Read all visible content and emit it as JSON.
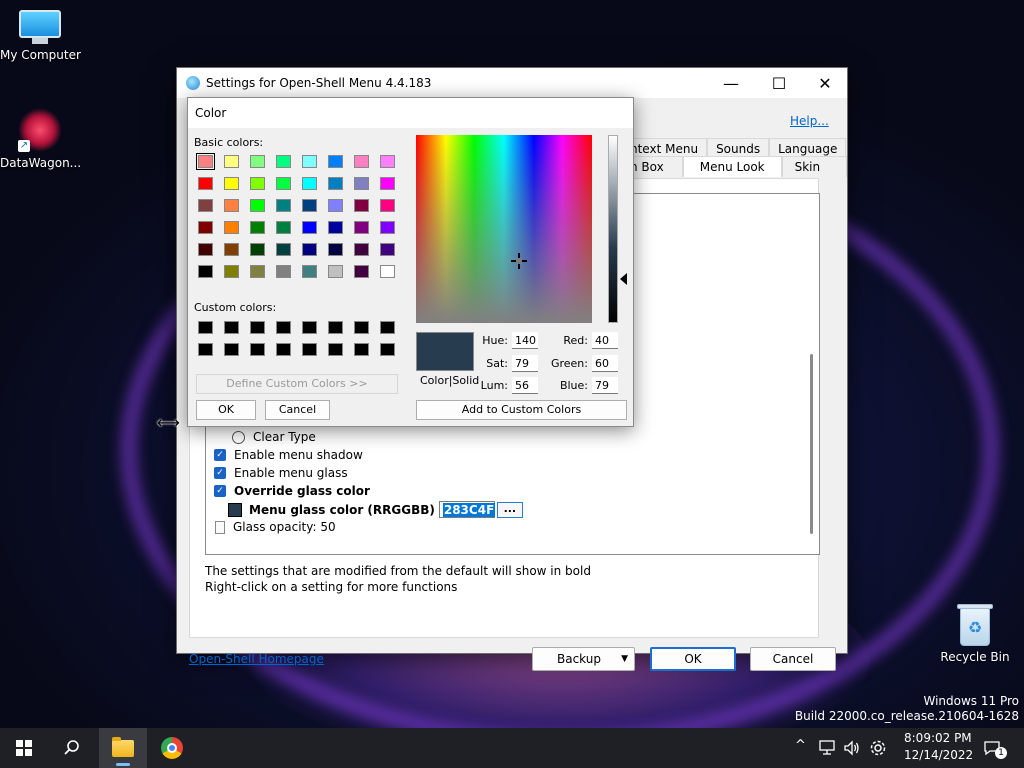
{
  "desktop": {
    "icons": [
      {
        "label": "My Computer"
      },
      {
        "label": "DataWagon..."
      },
      {
        "label": "Recycle Bin"
      }
    ],
    "watermark": {
      "line1": "Windows 11 Pro",
      "line2": "Build 22000.co_release.210604-1628"
    }
  },
  "settings_window": {
    "title": "Settings for Open-Shell Menu 4.4.183",
    "controls": {
      "minimize": "—",
      "maximize": "☐",
      "close": "✕"
    },
    "help_link": "Help...",
    "tabs_row1": [
      "ntext Menu",
      "Sounds",
      "Language"
    ],
    "tabs_row2": [
      "h Box",
      "Menu Look",
      "Skin"
    ],
    "active_tab": "Menu Look",
    "options": {
      "clear_type": "Clear Type",
      "menu_shadow": "Enable menu shadow",
      "menu_glass": "Enable menu glass",
      "override_glass": "Override glass color",
      "glass_color_label": "Menu glass color (RRGGBB)",
      "glass_color_value": "283C4F",
      "glass_color_button": "...",
      "glass_opacity": "Glass opacity: 50"
    },
    "footnote1": "The settings that are modified from the default will show in bold",
    "footnote2": "Right-click on a setting for more functions",
    "homepage_link": "Open-Shell Homepage",
    "buttons": {
      "backup": "Backup",
      "ok": "OK",
      "cancel": "Cancel"
    }
  },
  "color_dialog": {
    "title": "Color",
    "basic_colors_label": "Basic colors:",
    "custom_colors_label": "Custom colors:",
    "basic_colors": [
      [
        "#ff8080",
        "#ffff80",
        "#80ff80",
        "#00ff80",
        "#80ffff",
        "#0080ff",
        "#ff80c0",
        "#ff80ff"
      ],
      [
        "#ff0000",
        "#ffff00",
        "#80ff00",
        "#00ff40",
        "#00ffff",
        "#0080c0",
        "#8080c0",
        "#ff00ff"
      ],
      [
        "#804040",
        "#ff8040",
        "#00ff00",
        "#008080",
        "#004080",
        "#8080ff",
        "#800040",
        "#ff0080"
      ],
      [
        "#800000",
        "#ff8000",
        "#008000",
        "#008040",
        "#0000ff",
        "#0000a0",
        "#800080",
        "#8000ff"
      ],
      [
        "#400000",
        "#804000",
        "#004000",
        "#004040",
        "#000080",
        "#000040",
        "#400040",
        "#400080"
      ],
      [
        "#000000",
        "#808000",
        "#808040",
        "#808080",
        "#408080",
        "#c0c0c0",
        "#400040",
        "#ffffff"
      ]
    ],
    "custom_colors": [
      "#000000",
      "#000000",
      "#000000",
      "#000000",
      "#000000",
      "#000000",
      "#000000",
      "#000000",
      "#000000",
      "#000000",
      "#000000",
      "#000000",
      "#000000",
      "#000000",
      "#000000",
      "#000000"
    ],
    "define_custom_button": "Define Custom Colors >>",
    "ok_button": "OK",
    "cancel_button": "Cancel",
    "color_solid_label": "Color|Solid",
    "current_color": "#283c4f",
    "hue_label": "Hue:",
    "hue": "140",
    "sat_label": "Sat:",
    "sat": "79",
    "lum_label": "Lum:",
    "lum": "56",
    "red_label": "Red:",
    "red": "40",
    "green_label": "Green:",
    "green": "60",
    "blue_label": "Blue:",
    "blue": "79",
    "add_custom_button": "Add to Custom Colors"
  },
  "taskbar": {
    "time": "8:09:02 PM",
    "date": "12/14/2022",
    "notification_count": "1",
    "tray_chevron": "^"
  }
}
